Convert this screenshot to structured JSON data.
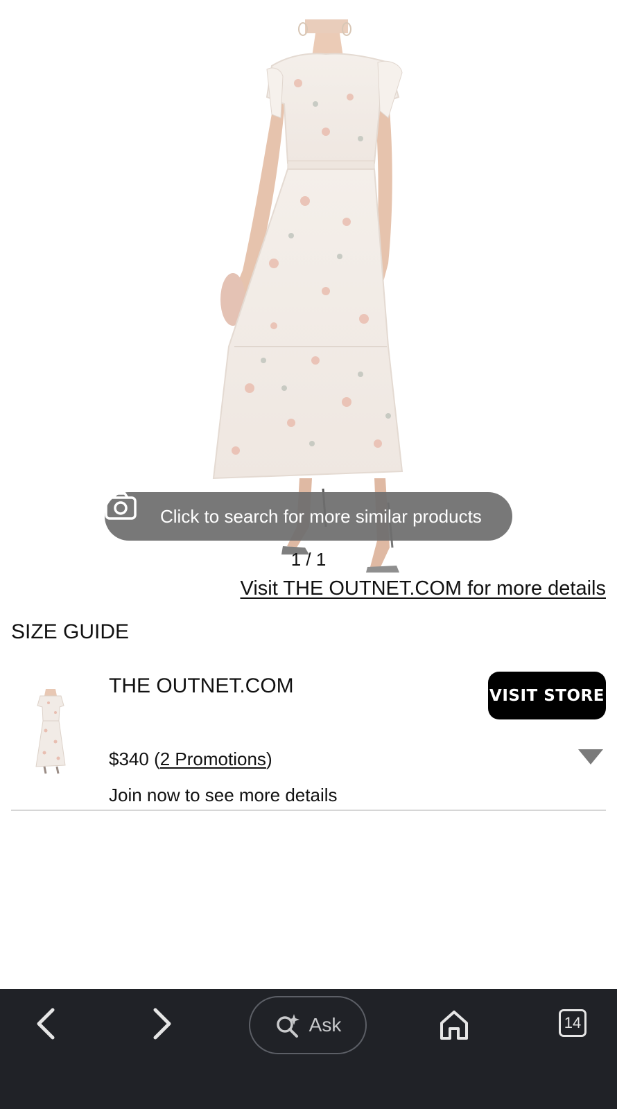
{
  "product_image": {
    "alt": ""
  },
  "image_search": {
    "label": "Click to search for more similar products",
    "icon": "camera-icon"
  },
  "image_counter": "1 / 1",
  "visit_link": "Visit THE OUTNET.COM for more details",
  "size_guide": "SIZE GUIDE",
  "offer": {
    "store_name": "THE OUTNET.COM",
    "visit_store_label": "VISIT STORE",
    "price": "$340",
    "promotions_label": "2 Promotions",
    "join_text": "Join now to see more details"
  },
  "bottom_nav": {
    "back_icon": "chevron-left-icon",
    "forward_icon": "chevron-right-icon",
    "ask_label": "Ask",
    "ask_icon": "sparkle-search-icon",
    "home_icon": "home-icon",
    "tab_count": "14"
  },
  "colors": {
    "nav_background": "#202227",
    "pill_background": "#6e6e6e",
    "button_black": "#000000"
  }
}
